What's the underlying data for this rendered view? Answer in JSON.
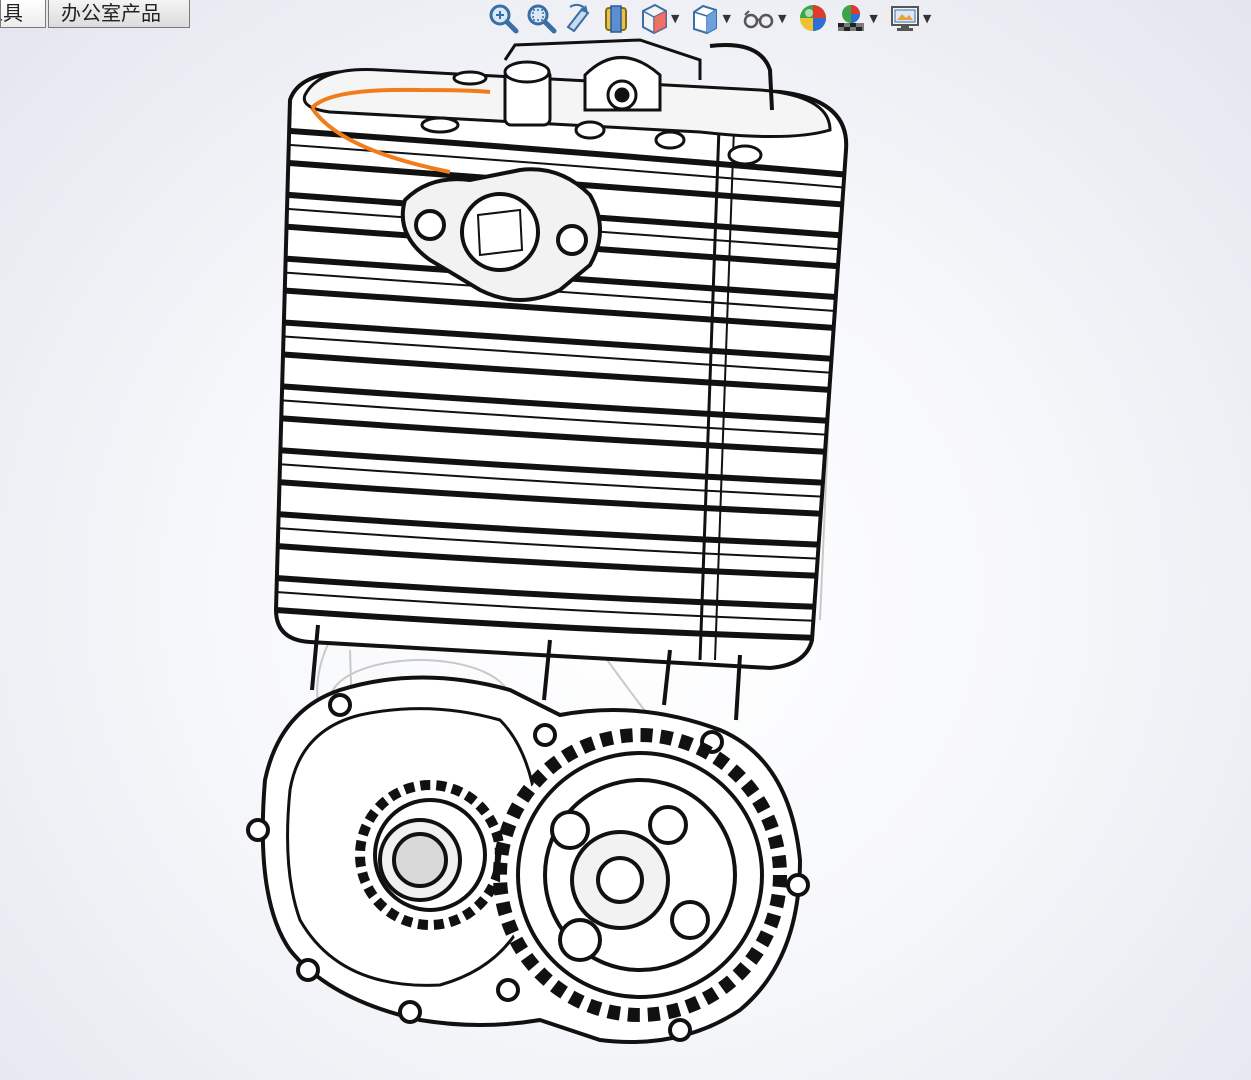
{
  "tabs": [
    {
      "label": "工具"
    },
    {
      "label": "办公室产品"
    }
  ],
  "toolbar": {
    "items": [
      {
        "icon": "zoom-to-fit-icon",
        "dropdown": false
      },
      {
        "icon": "zoom-to-area-icon",
        "dropdown": false
      },
      {
        "icon": "previous-view-icon",
        "dropdown": false
      },
      {
        "icon": "section-view-icon",
        "dropdown": false
      },
      {
        "icon": "view-orientation-icon",
        "dropdown": true
      },
      {
        "icon": "display-style-icon",
        "dropdown": true
      },
      {
        "icon": "hide-show-items-icon",
        "dropdown": true
      },
      {
        "icon": "edit-appearance-icon",
        "dropdown": false
      },
      {
        "icon": "apply-scene-icon",
        "dropdown": true
      },
      {
        "icon": "view-settings-icon",
        "dropdown": true
      }
    ]
  },
  "viewport": {
    "model": "engine-assembly",
    "display_style": "hidden-lines-visible",
    "accent_color": "#f07d1a"
  }
}
